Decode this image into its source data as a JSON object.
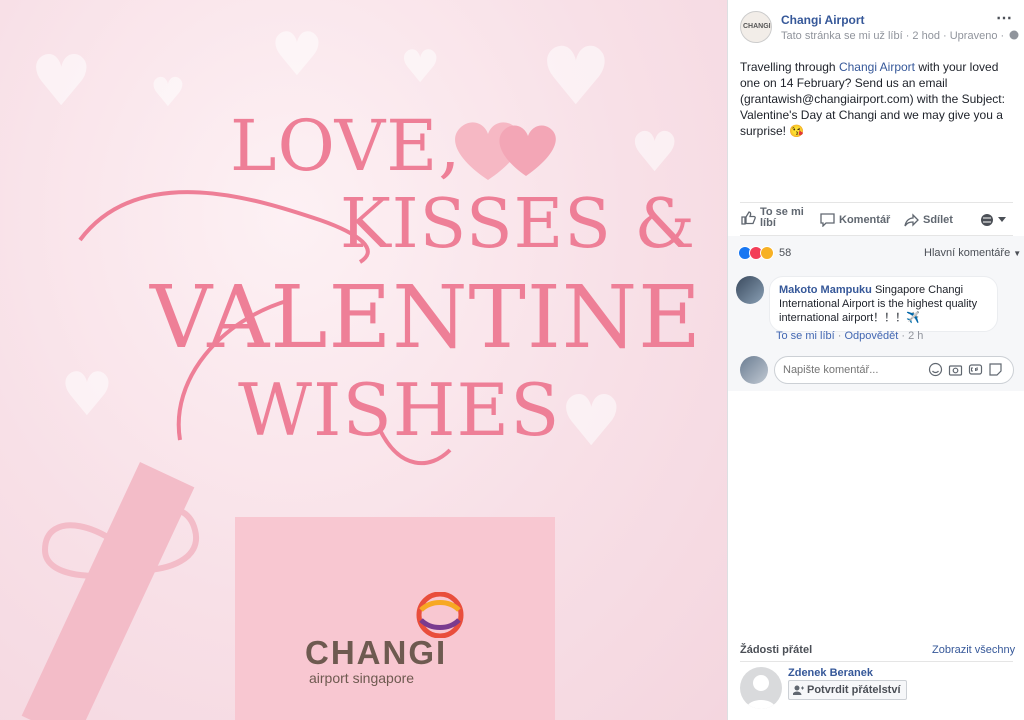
{
  "image": {
    "title_lines": [
      "LOVE,",
      "KISSES &",
      "VALENTINE",
      "WISHES"
    ],
    "logo": {
      "name": "CHANGI",
      "tagline": "airport singapore"
    }
  },
  "post": {
    "page_name": "Changi Airport",
    "avatar_text": "CHANGI",
    "meta": "Tato stránka se mi už líbí · 2 hod · Upraveno ·",
    "text_before": "Travelling through ",
    "text_link": "Changi Airport",
    "text_after": " with your loved one on 14 February? Send us an email (grantawish@changiairport.com) with the Subject: Valentine's Day at Changi and we may give you a surprise! 😘",
    "more_icon": "⋯",
    "actions": {
      "like": "To se mi líbí",
      "comment": "Komentář",
      "share": "Sdílet"
    },
    "reactions": {
      "count": "58",
      "colors": [
        "#1877f2",
        "#f33e58",
        "#f7b125"
      ]
    },
    "sort_label": "Hlavní komentáře"
  },
  "comment": {
    "author": "Makoto Mampuku",
    "text": " Singapore Changi International Airport is the highest quality international airport！！！✈️",
    "like": "To se mi líbí",
    "reply": "Odpovědět",
    "time": "2 h"
  },
  "composer": {
    "placeholder": "Napište komentář..."
  },
  "friend_requests": {
    "title": "Žádosti přátel",
    "see_all": "Zobrazit všechny",
    "name": "Zdenek Beranek",
    "confirm": "Potvrdit přátelství"
  }
}
